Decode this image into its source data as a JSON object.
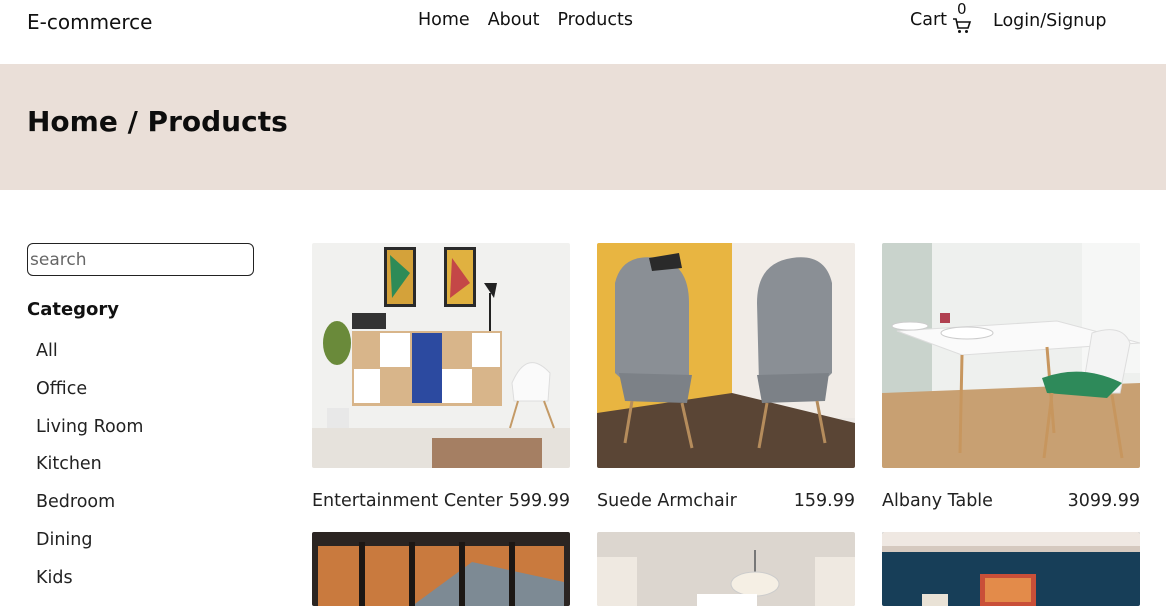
{
  "header": {
    "brand": "E-commerce",
    "nav": [
      "Home",
      "About",
      "Products"
    ],
    "cart_label": "Cart",
    "cart_count": "0",
    "login": "Login/Signup"
  },
  "hero": {
    "title": "Home / Products"
  },
  "sidebar": {
    "search_placeholder": "search",
    "category_title": "Category",
    "categories": [
      "All",
      "Office",
      "Living Room",
      "Kitchen",
      "Bedroom",
      "Dining",
      "Kids"
    ]
  },
  "products": [
    {
      "name": "Entertainment Center",
      "price": "599.99"
    },
    {
      "name": "Suede Armchair",
      "price": "159.99"
    },
    {
      "name": "Albany Table",
      "price": "3099.99"
    }
  ],
  "colors": {
    "hero_bg": "#eadfd8",
    "text": "#111111"
  }
}
